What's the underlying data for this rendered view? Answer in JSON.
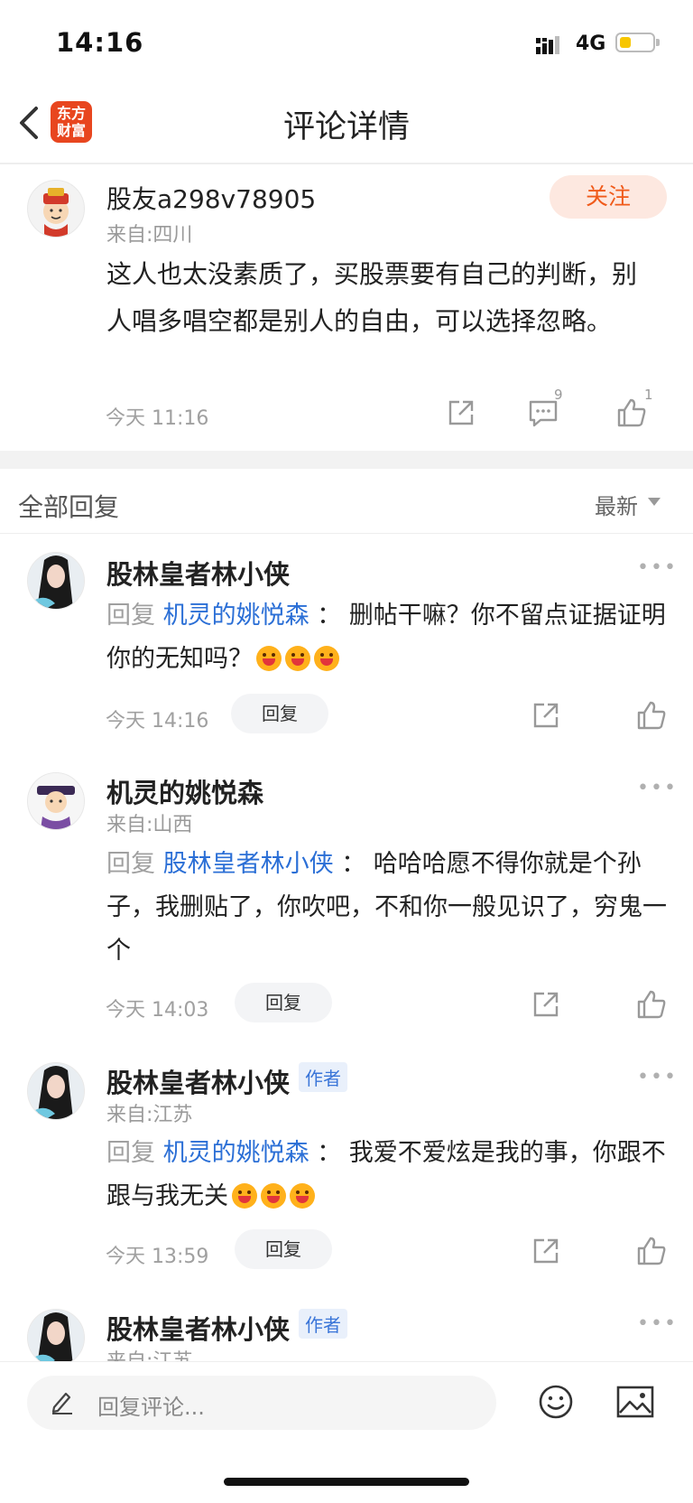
{
  "status_bar": {
    "time": "14:16",
    "network": "4G",
    "battery_level": 0.35
  },
  "header": {
    "title": "评论详情",
    "logo_line1": "东方",
    "logo_line2": "财富",
    "back_icon": "chevron-left-icon"
  },
  "main_comment": {
    "username": "股友a298v78905",
    "location": "来自:四川",
    "follow_label": "关注",
    "text": "这人也太没素质了，买股票要有自己的判断，别人唱多唱空都是别人的自由，可以选择忽略。",
    "time": "今天 11:16",
    "comment_count": "9",
    "like_count": "1"
  },
  "replies_section": {
    "title": "全部回复",
    "sort_label": "最新"
  },
  "replies": [
    {
      "name": "股林皇者林小侠",
      "badge": "",
      "location": "",
      "reply_prefix": "回复",
      "target": "机灵的姚悦森",
      "separator": "：",
      "text": "删帖干嘛？你不留点证据证明你的无知吗？",
      "time": "今天 14:16",
      "reply_label": "回复"
    },
    {
      "name": "机灵的姚悦森",
      "badge": "",
      "location": "来自:山西",
      "reply_prefix": "回复",
      "target": "股林皇者林小侠",
      "separator": "：",
      "text": "哈哈哈愿不得你就是个孙子，我删贴了，你吹吧，不和你一般见识了，穷鬼一个",
      "time": "今天 14:03",
      "reply_label": "回复"
    },
    {
      "name": "股林皇者林小侠",
      "badge": "作者",
      "location": "来自:江苏",
      "reply_prefix": "回复",
      "target": "机灵的姚悦森",
      "separator": "：",
      "text": "我爱不爱炫是我的事，你跟不跟与我无关",
      "time": "今天 13:59",
      "reply_label": "回复"
    },
    {
      "name": "股林皇者林小侠",
      "badge": "作者",
      "location": "来自:江苏"
    }
  ],
  "bottom_bar": {
    "placeholder": "回复评论..."
  },
  "colors": {
    "accent": "#f05a1a",
    "link": "#2b6fd6",
    "logo": "#e8461f"
  }
}
